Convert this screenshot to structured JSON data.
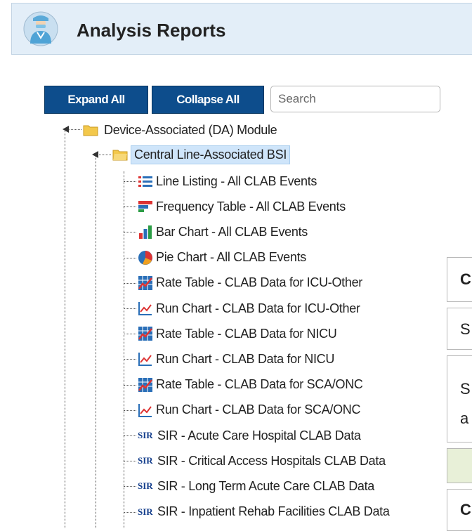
{
  "header": {
    "title": "Analysis Reports",
    "icon": "doctor-avatar-icon"
  },
  "toolbar": {
    "expand_label": "Expand All",
    "collapse_label": "Collapse All",
    "search_placeholder": "Search"
  },
  "tree": {
    "module": {
      "label": "Device-Associated (DA) Module",
      "icon": "folder-icon"
    },
    "group": {
      "label": "Central Line-Associated BSI",
      "icon": "folder-open-icon",
      "selected": true
    },
    "items": [
      {
        "label": "Line Listing - All CLAB Events",
        "icon": "line-listing-icon"
      },
      {
        "label": "Frequency Table - All CLAB Events",
        "icon": "frequency-table-icon"
      },
      {
        "label": "Bar Chart - All CLAB Events",
        "icon": "bar-chart-icon"
      },
      {
        "label": "Pie Chart - All CLAB Events",
        "icon": "pie-chart-icon"
      },
      {
        "label": "Rate Table - CLAB Data for ICU-Other",
        "icon": "rate-table-icon"
      },
      {
        "label": "Run Chart - CLAB Data for ICU-Other",
        "icon": "run-chart-icon"
      },
      {
        "label": "Rate Table - CLAB Data for NICU",
        "icon": "rate-table-icon"
      },
      {
        "label": "Run Chart - CLAB Data for NICU",
        "icon": "run-chart-icon"
      },
      {
        "label": "Rate Table - CLAB Data for SCA/ONC",
        "icon": "rate-table-icon"
      },
      {
        "label": "Run Chart - CLAB Data for SCA/ONC",
        "icon": "run-chart-icon"
      },
      {
        "label": "SIR - Acute Care Hospital CLAB Data",
        "icon": "sir-icon"
      },
      {
        "label": "SIR - Critical Access Hospitals CLAB Data",
        "icon": "sir-icon"
      },
      {
        "label": "SIR - Long Term Acute Care CLAB Data",
        "icon": "sir-icon"
      },
      {
        "label": "SIR - Inpatient Rehab Facilities CLAB Data",
        "icon": "sir-icon"
      }
    ],
    "sir_text": "SIR"
  },
  "side_panel": {
    "row1": "C",
    "row2": "S",
    "row3a": "S",
    "row3b": "a",
    "row5": "C"
  },
  "colors": {
    "header_bg": "#e3eef8",
    "button_bg": "#0d4d8c",
    "selected_bg": "#cfe5fa",
    "panel_green": "#e8f0d8"
  }
}
